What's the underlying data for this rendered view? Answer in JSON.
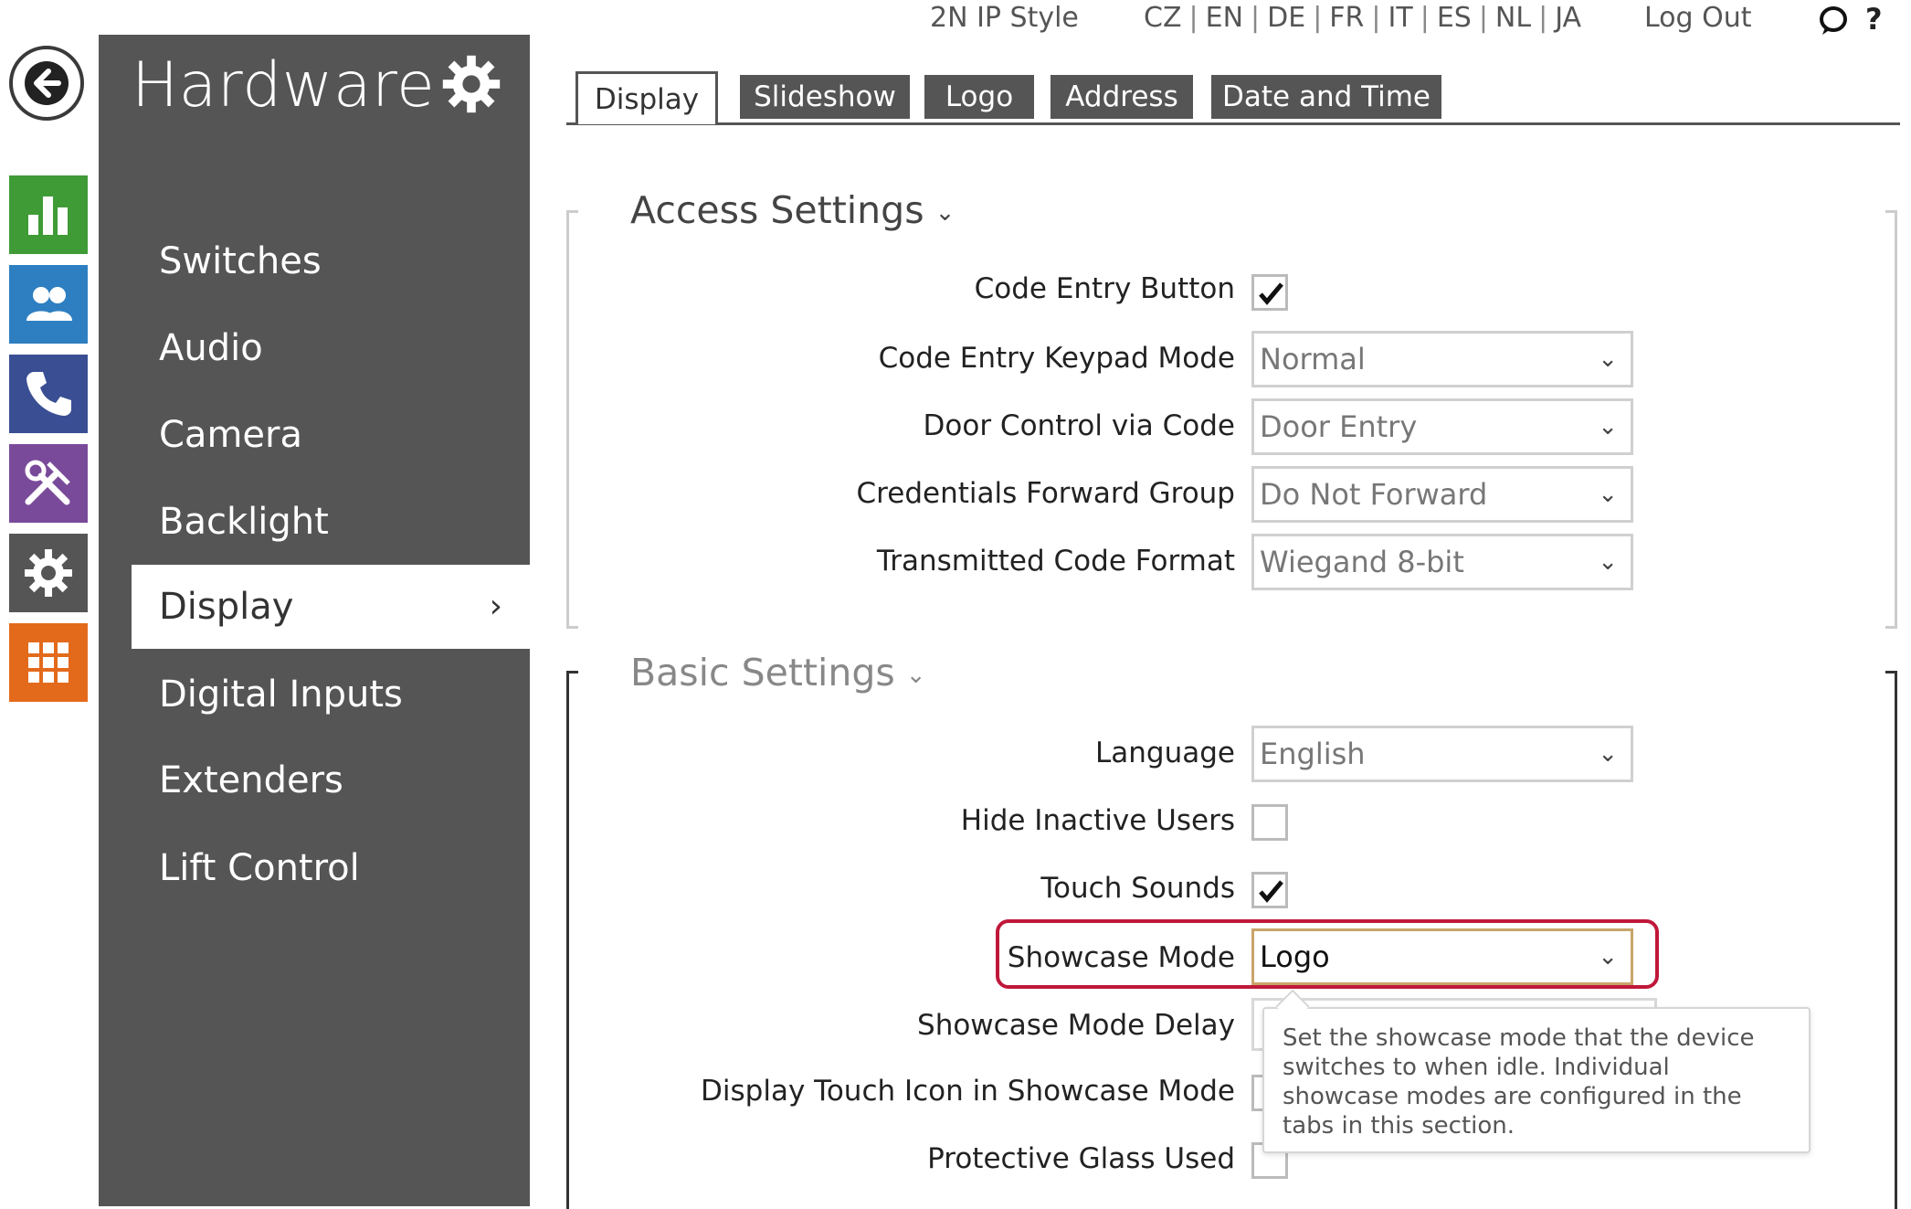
{
  "topbar": {
    "style_label": "2N IP Style",
    "languages": [
      "CZ",
      "EN",
      "DE",
      "FR",
      "IT",
      "ES",
      "NL",
      "JA"
    ],
    "logout_label": "Log Out",
    "help_label": "?"
  },
  "sidebar": {
    "title": "Hardware",
    "items": [
      {
        "label": "Switches"
      },
      {
        "label": "Audio"
      },
      {
        "label": "Camera"
      },
      {
        "label": "Backlight"
      },
      {
        "label": "Display",
        "active": true
      },
      {
        "label": "Digital Inputs"
      },
      {
        "label": "Extenders"
      },
      {
        "label": "Lift Control"
      }
    ],
    "active_chevron": "›"
  },
  "rail": {
    "colors": {
      "status": "#3f9b36",
      "directory": "#2e7fc1",
      "calls": "#3a4f93",
      "hardware": "#7a4a9a",
      "system": "#555555",
      "services": "#e36a1b"
    }
  },
  "tabs": [
    {
      "label": "Display",
      "active": true
    },
    {
      "label": "Slideshow"
    },
    {
      "label": "Logo"
    },
    {
      "label": "Address"
    },
    {
      "label": "Date and Time"
    }
  ],
  "access_settings": {
    "title": "Access Settings",
    "code_entry_button": {
      "label": "Code Entry Button",
      "checked": true
    },
    "keypad_mode": {
      "label": "Code Entry Keypad Mode",
      "value": "Normal"
    },
    "door_control": {
      "label": "Door Control via Code",
      "value": "Door Entry"
    },
    "forward_group": {
      "label": "Credentials Forward Group",
      "value": "Do Not Forward"
    },
    "code_format": {
      "label": "Transmitted Code Format",
      "value": "Wiegand 8-bit"
    }
  },
  "basic_settings": {
    "title": "Basic Settings",
    "language": {
      "label": "Language",
      "value": "English"
    },
    "hide_inactive": {
      "label": "Hide Inactive Users",
      "checked": false
    },
    "touch_sounds": {
      "label": "Touch Sounds",
      "checked": true
    },
    "showcase_mode": {
      "label": "Showcase Mode",
      "value": "Logo"
    },
    "showcase_delay": {
      "label": "Showcase Mode Delay"
    },
    "touch_icon": {
      "label": "Display Touch Icon in Showcase Mode"
    },
    "protective_glass": {
      "label": "Protective Glass Used",
      "checked": false
    }
  },
  "tooltip": {
    "text": "Set the showcase mode that the device switches to when idle. Individual showcase modes are configured in the tabs in this section."
  },
  "colors": {
    "highlight": "#c0183a",
    "sidebar_bg": "#555555",
    "select_highlight": "#c9a46a"
  }
}
